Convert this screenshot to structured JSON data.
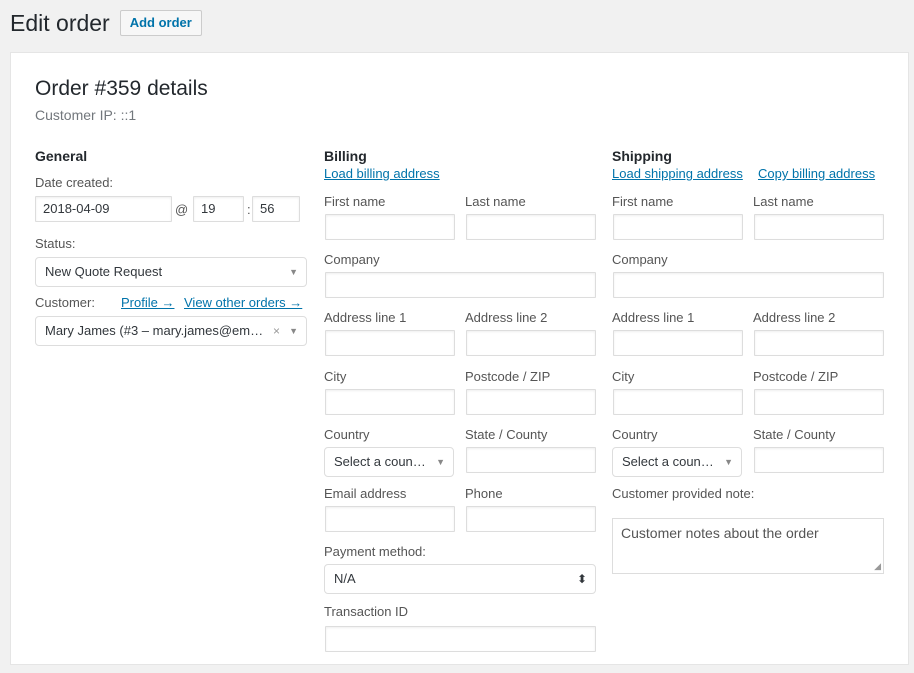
{
  "header": {
    "title": "Edit order",
    "add_label": "Add order"
  },
  "order": {
    "title": "Order #359 details",
    "customer_ip": "Customer IP: ::1"
  },
  "general": {
    "heading": "General",
    "date_label": "Date created:",
    "date_value": "2018-04-09",
    "at": "@",
    "hour": "19",
    "colon": ":",
    "minute": "56",
    "status_label": "Status:",
    "status_value": "New Quote Request",
    "customer_label": "Customer:",
    "profile_link": "Profile →",
    "view_orders_link": "View other orders →",
    "customer_value": "Mary James (#3 – mary.james@em…"
  },
  "billing": {
    "heading": "Billing",
    "load_link": "Load billing address",
    "first_name": "First name",
    "last_name": "Last name",
    "company": "Company",
    "address1": "Address line 1",
    "address2": "Address line 2",
    "city": "City",
    "postcode": "Postcode / ZIP",
    "country": "Country",
    "state": "State / County",
    "country_value": "Select a coun…",
    "email": "Email address",
    "phone": "Phone",
    "payment_label": "Payment method:",
    "payment_value": "N/A",
    "transaction_label": "Transaction ID"
  },
  "shipping": {
    "heading": "Shipping",
    "load_link": "Load shipping address",
    "copy_link": "Copy billing address",
    "first_name": "First name",
    "last_name": "Last name",
    "company": "Company",
    "address1": "Address line 1",
    "address2": "Address line 2",
    "city": "City",
    "postcode": "Postcode / ZIP",
    "country": "Country",
    "state": "State / County",
    "country_value": "Select a coun…",
    "note_label": "Customer provided note:",
    "note_placeholder": "Customer notes about the order"
  },
  "icons": {
    "dropdown": "caret-down-icon",
    "clear": "clear-x-icon",
    "updown": "updown-arrows-icon"
  }
}
